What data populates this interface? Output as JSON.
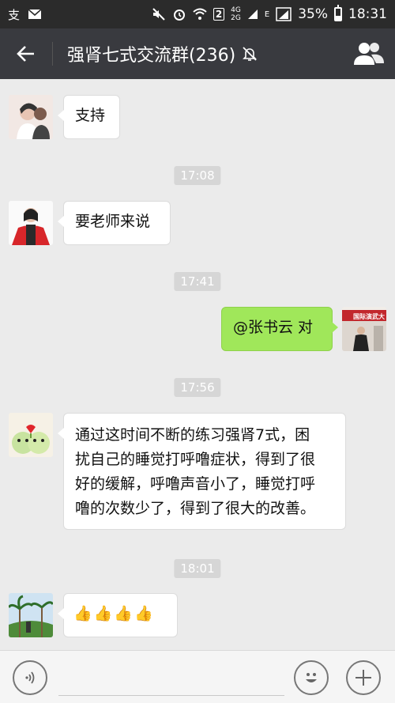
{
  "status_bar": {
    "network_top": "4G",
    "network_bottom": "2G",
    "sim_badge": "2",
    "data_type": "E",
    "battery": "35%",
    "time": "18:31"
  },
  "header": {
    "title": "强肾七式交流群(236)",
    "muted_icon": "bell-off-icon",
    "members_icon": "group-members-icon"
  },
  "messages": [
    {
      "type": "text",
      "side": "left",
      "text": "支持"
    },
    {
      "type": "time",
      "text": "17:08"
    },
    {
      "type": "text",
      "side": "left",
      "text": "要老师来说"
    },
    {
      "type": "time",
      "text": "17:41"
    },
    {
      "type": "text",
      "side": "right",
      "text": "@张书云 对"
    },
    {
      "type": "time",
      "text": "17:56"
    },
    {
      "type": "text",
      "side": "left",
      "lines": [
        "通过这时间不断的练习强肾7式，困",
        "扰自己的睡觉打呼噜症状，得到了很",
        "好的缓解，呼噜声音小了，睡觉打呼",
        "噜的次数少了，得到了很大的改善。"
      ]
    },
    {
      "type": "time",
      "text": "18:01"
    },
    {
      "type": "text",
      "side": "left",
      "text": "👍👍👍👍"
    }
  ],
  "right_avatar_banner": "国际演武大",
  "input_bar": {
    "voice_icon": "voice-icon",
    "emoji_icon": "emoji-icon",
    "plus_icon": "plus-icon"
  }
}
